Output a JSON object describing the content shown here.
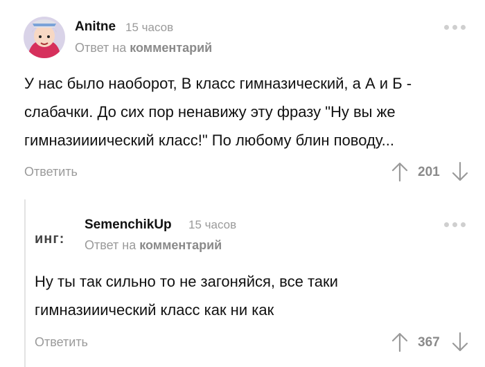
{
  "comment1": {
    "author": "Anitne",
    "time": "15 часов",
    "reply_prefix": "Ответ на",
    "reply_link": "комментарий",
    "lines": [
      "У нас было наоборот, В класс гимназический, а А и Б -",
      "слабачки. До сих пор ненавижу эту фразу \"Ну вы же",
      "гимназиииический класс!\" По любому блин поводу..."
    ],
    "reply_label": "Ответить",
    "score": "201"
  },
  "comment2": {
    "author": "SemenchikUp",
    "time": "15 часов",
    "avatar_text": "инг:",
    "reply_prefix": "Ответ на",
    "reply_link": "комментарий",
    "lines": [
      "Ну ты так сильно то не загоняйся, все таки",
      "гимназииический класс как ни как"
    ],
    "reply_label": "Ответить",
    "score": "367"
  },
  "icons": {
    "menu": "more-dots-icon",
    "upvote": "arrow-up-icon",
    "downvote": "arrow-down-icon"
  },
  "colors": {
    "text": "#111111",
    "muted": "#9a9a9a",
    "thread_line": "#e2e2e2"
  }
}
